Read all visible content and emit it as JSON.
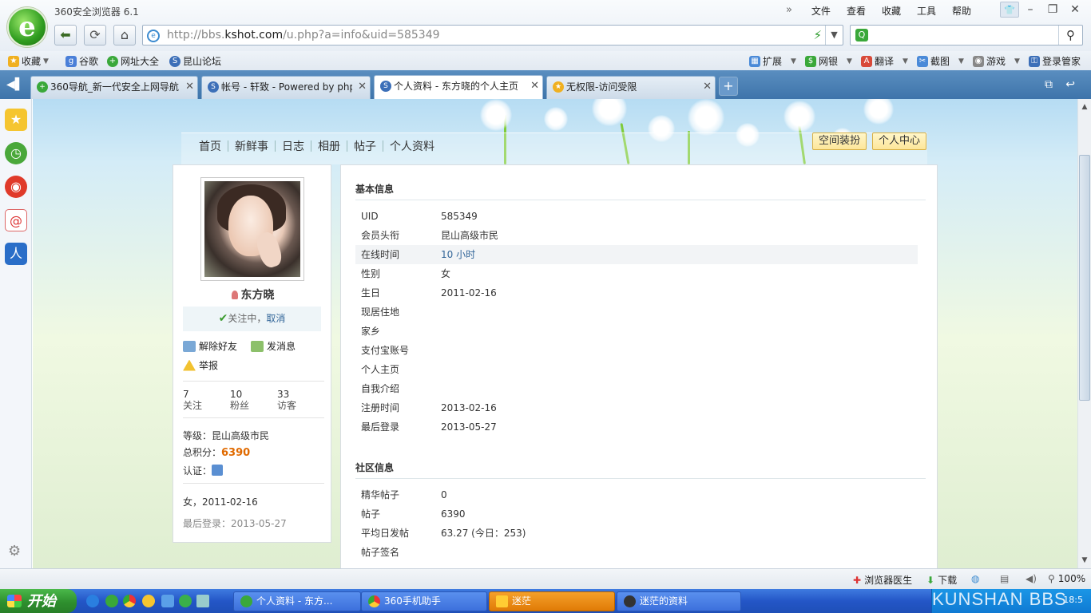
{
  "browser": {
    "title": "360安全浏览器 6.1",
    "menu": [
      "文件",
      "查看",
      "收藏",
      "工具",
      "帮助"
    ],
    "url_prefix": "http://bbs.",
    "url_domain": "kshot.com",
    "url_path": "/u.php?a=info&uid=585349"
  },
  "bookmarks": {
    "left": [
      "收藏",
      "谷歌",
      "网址大全",
      "昆山论坛"
    ],
    "right": [
      "扩展",
      "网银",
      "翻译",
      "截图",
      "游戏",
      "登录管家"
    ]
  },
  "tabs": [
    {
      "label": "360导航_新一代安全上网导航"
    },
    {
      "label": "帐号 - 轩致 - Powered by phpwind"
    },
    {
      "label": "个人资料 - 东方晓的个人主页"
    },
    {
      "label": "无权限-访问受限"
    }
  ],
  "topnav": {
    "items": [
      "首页",
      "新鲜事",
      "日志",
      "相册",
      "帖子",
      "个人资料"
    ],
    "decorate": "空间装扮",
    "center": "个人中心"
  },
  "profile": {
    "name": "东方晓",
    "following_text": "关注中，",
    "cancel": "取消",
    "remove_friend": "解除好友",
    "send_message": "发消息",
    "report": "举报",
    "stats": [
      {
        "value": "7",
        "label": "关注"
      },
      {
        "value": "10",
        "label": "粉丝"
      },
      {
        "value": "33",
        "label": "访客"
      }
    ],
    "level_label": "等级：",
    "level": "昆山高级市民",
    "points_label": "总积分：",
    "points": "6390",
    "cert_label": "认证：",
    "gender_birthday": "女，2011-02-16",
    "last_login": "最后登录：2013-05-27"
  },
  "basic": {
    "title": "基本信息",
    "rows": [
      {
        "k": "UID",
        "v": "585349"
      },
      {
        "k": "会员头衔",
        "v": "昆山高级市民"
      },
      {
        "k": "在线时间",
        "v": "10 小时"
      },
      {
        "k": "性别",
        "v": "女"
      },
      {
        "k": "生日",
        "v": "2011-02-16"
      },
      {
        "k": "现居住地",
        "v": ""
      },
      {
        "k": "家乡",
        "v": ""
      },
      {
        "k": "支付宝账号",
        "v": ""
      },
      {
        "k": "个人主页",
        "v": ""
      },
      {
        "k": "自我介绍",
        "v": ""
      },
      {
        "k": "注册时间",
        "v": "2013-02-16"
      },
      {
        "k": "最后登录",
        "v": "2013-05-27"
      }
    ]
  },
  "community": {
    "title": "社区信息",
    "rows": [
      {
        "k": "精华帖子",
        "v": "0"
      },
      {
        "k": "帖子",
        "v": "6390"
      },
      {
        "k": "平均日发帖",
        "v": "63.27 (今日：253)"
      },
      {
        "k": "帖子签名",
        "v": ""
      }
    ]
  },
  "status": {
    "doctor": "浏览器医生",
    "download": "下载",
    "zoom": "100%"
  },
  "taskbar": {
    "start": "开始",
    "tasks": [
      "个人资料 - 东方...",
      "360手机助手",
      "迷茫",
      "迷茫的资料"
    ],
    "watermark": "KUNSHAN BBS",
    "time": "18:5"
  }
}
